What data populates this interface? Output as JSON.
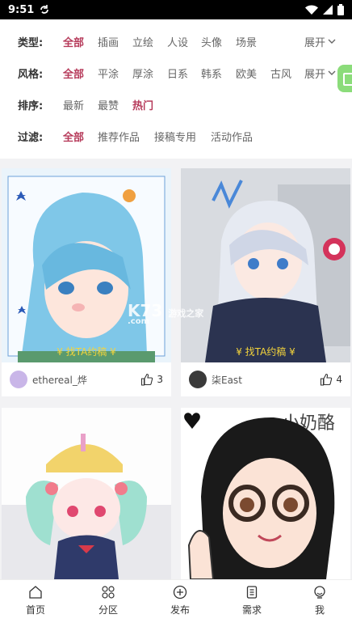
{
  "status": {
    "time": "9:51"
  },
  "filters": {
    "type": {
      "label": "类型:",
      "options": [
        "全部",
        "插画",
        "立绘",
        "人设",
        "头像",
        "场景"
      ],
      "expand": "展开"
    },
    "style": {
      "label": "风格:",
      "options": [
        "全部",
        "平涂",
        "厚涂",
        "日系",
        "韩系",
        "欧美",
        "古风"
      ],
      "expand": "展开"
    },
    "sort": {
      "label": "排序:",
      "options": [
        "最新",
        "最赞",
        "热门"
      ]
    },
    "filter": {
      "label": "过滤:",
      "options": [
        "全部",
        "推荐作品",
        "接稿专用",
        "活动作品"
      ]
    }
  },
  "cards": [
    {
      "tag": "¥ 找TA约稿 ¥",
      "author": "ethereal_烨",
      "likes": "3"
    },
    {
      "tag": "¥ 找TA约稿 ¥",
      "author": "柒East",
      "likes": "4"
    }
  ],
  "watermark": {
    "main": "K73",
    "sub": "游戏之家",
    "url": ".com"
  },
  "nav": [
    "首页",
    "分区",
    "发布",
    "需求",
    "我"
  ],
  "colors": {
    "accent": "#b63a5a",
    "tag": "#f4d43b"
  }
}
